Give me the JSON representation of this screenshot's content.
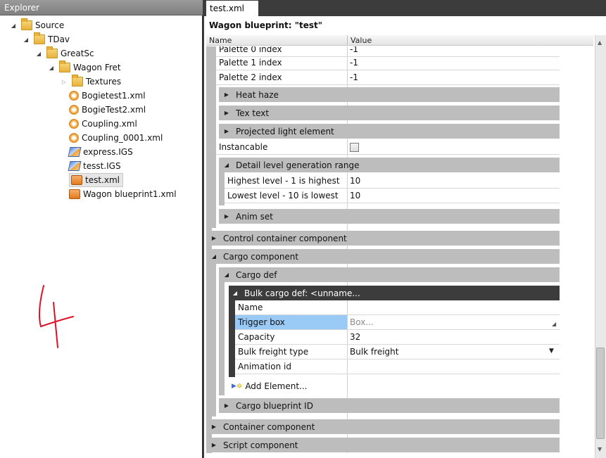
{
  "explorer": {
    "title": "Explorer",
    "items": [
      {
        "label": "Source",
        "icon": "folder-icon"
      },
      {
        "label": "TDav",
        "icon": "folder-icon"
      },
      {
        "label": "GreatSc",
        "icon": "folder-icon"
      },
      {
        "label": "Wagon Fret",
        "icon": "folder-icon"
      },
      {
        "label": "Textures",
        "icon": "folder-icon"
      },
      {
        "label": "Bogietest1.xml",
        "icon": "xml-file-icon"
      },
      {
        "label": "BogieTest2.xml",
        "icon": "xml-file-icon"
      },
      {
        "label": "Coupling.xml",
        "icon": "xml-file-icon"
      },
      {
        "label": "Coupling_0001.xml",
        "icon": "xml-file-icon"
      },
      {
        "label": "express.IGS",
        "icon": "igs-file-icon"
      },
      {
        "label": "tesst.IGS",
        "icon": "igs-file-icon"
      },
      {
        "label": "test.xml",
        "icon": "wagon-blueprint-icon"
      },
      {
        "label": "Wagon blueprint1.xml",
        "icon": "wagon-blueprint-icon"
      }
    ]
  },
  "annotation": {
    "text": "4"
  },
  "editor": {
    "tab_label": "test.xml",
    "title": "Wagon blueprint: \"test\"",
    "col_name": "Name",
    "col_value": "Value",
    "rows": {
      "palette0_name": "Palette 0 index",
      "palette0_value": "-1",
      "palette1_name": "Palette 1 index",
      "palette1_value": "-1",
      "palette2_name": "Palette 2 index",
      "palette2_value": "-1",
      "heat_haze": "Heat haze",
      "tex_text": "Tex text",
      "projected_light": "Projected light element",
      "instancable": "Instancable",
      "detail_range": "Detail level generation range",
      "highest_name": "Highest level - 1 is highest",
      "highest_value": "10",
      "lowest_name": "Lowest level - 10 is lowest",
      "lowest_value": "10",
      "anim_set": "Anim set",
      "control_container": "Control container component",
      "cargo_component": "Cargo component",
      "cargo_def": "Cargo def",
      "bulk_cargo_def": "Bulk cargo def: <unname...",
      "name_label": "Name",
      "trigger_box_name": "Trigger box",
      "trigger_box_value": "Box...",
      "capacity_name": "Capacity",
      "capacity_value": "32",
      "bulk_freight_name": "Bulk freight type",
      "bulk_freight_value": "Bulk freight",
      "animation_id": "Animation id",
      "add_element": "Add Element...",
      "cargo_blueprint_id": "Cargo blueprint ID",
      "container_component": "Container component",
      "script_component": "Script component"
    }
  },
  "colors": {
    "group_gray": "#bdbdbd",
    "dark_header": "#3c3c3c",
    "selection_blue": "#99c9f5",
    "annotation_red": "#e0102a"
  }
}
